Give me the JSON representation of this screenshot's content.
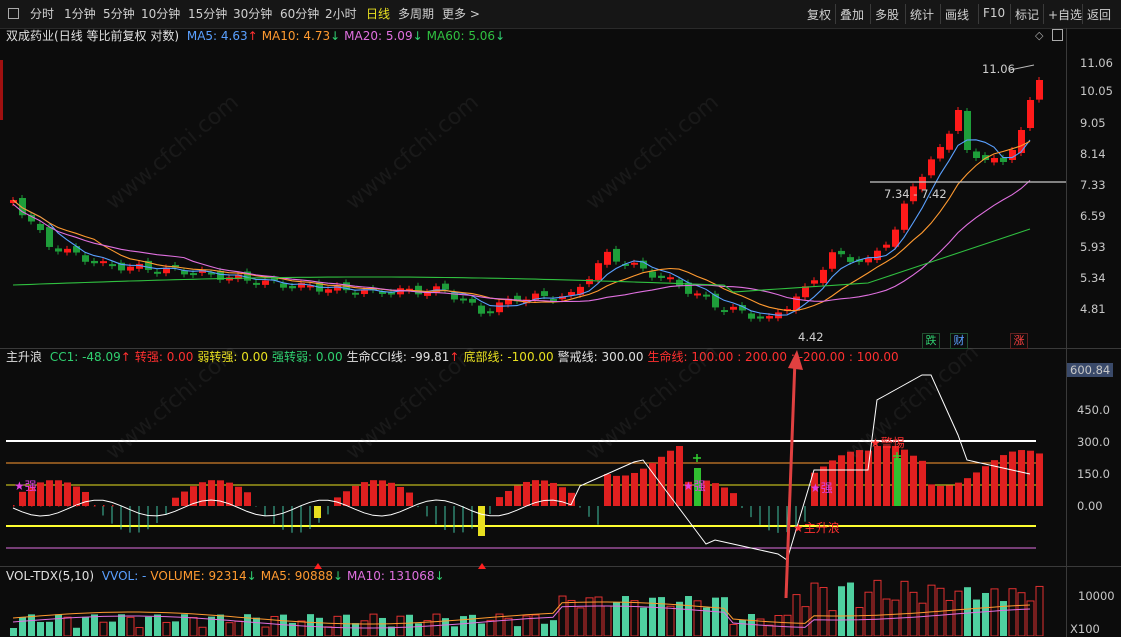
{
  "toolbar": {
    "left": [
      "分时",
      "1分钟",
      "5分钟",
      "10分钟",
      "15分钟",
      "30分钟",
      "60分钟",
      "2小时",
      "日线",
      "多周期",
      "更多 >"
    ],
    "active": "日线",
    "right": [
      "复权",
      "叠加",
      "多股",
      "统计",
      "画线",
      "F10",
      "标记",
      "+自选",
      "返回"
    ]
  },
  "main": {
    "title": "双成药业",
    "subtitle": "(日线 等比前复权 对数)",
    "ma": [
      {
        "label": "MA5: 4.63",
        "arrow": "↑",
        "color": "#5aa0ff",
        "arrow_color": "#ff3030"
      },
      {
        "label": "MA10: 4.73",
        "arrow": "↓",
        "color": "#ff9a30",
        "arrow_color": "#30d070"
      },
      {
        "label": "MA20: 5.09",
        "arrow": "↓",
        "color": "#e070e0",
        "arrow_color": "#30d070"
      },
      {
        "label": "MA60: 5.06",
        "arrow": "↓",
        "color": "#30c040",
        "arrow_color": "#30d070"
      }
    ],
    "price_axis": [
      "11.06",
      "10.05",
      "9.05",
      "8.14",
      "7.33",
      "6.59",
      "5.93",
      "5.34",
      "4.81"
    ],
    "annot_high": "11.06",
    "annot_low": "4.42",
    "annot_gap": "7.34 - 7.42",
    "badges": [
      {
        "t": "跌",
        "color": "#30d070"
      },
      {
        "t": "财",
        "color": "#5aa0ff"
      },
      {
        "t": "涨",
        "color": "#ff4040"
      }
    ]
  },
  "indicator": {
    "name": "主升浪",
    "items": [
      {
        "label": "CC1: -48.09",
        "arrow": "↑",
        "color": "#30d070",
        "arrow_color": "#ff3030"
      },
      {
        "label": "转强: 0.00",
        "color": "#ff3030"
      },
      {
        "label": "弱转强: 0.00",
        "color": "#e8e020"
      },
      {
        "label": "强转弱: 0.00",
        "color": "#30d070"
      },
      {
        "label": "生命CCI线: -99.81",
        "arrow": "↑",
        "color": "#e0e0e0",
        "arrow_color": "#ff3030"
      },
      {
        "label": "底部线: -100.00",
        "color": "#e8e020"
      },
      {
        "label": "警戒线: 300.00",
        "color": "#e0e0e0"
      },
      {
        "label": "生命线: 100.00 : 200.00 : -200.00 : 100.00",
        "color": "#ff3030"
      }
    ],
    "axis": [
      "600.84",
      "450.0",
      "300.0",
      "150.0",
      "0.00"
    ],
    "marks": [
      {
        "t": "★强",
        "color": "#e040e0"
      },
      {
        "t": "★强",
        "color": "#e040e0"
      },
      {
        "t": "★强",
        "color": "#e040e0"
      },
      {
        "t": "★警惕",
        "color": "#ff3030"
      },
      {
        "t": "★主升浪",
        "color": "#ff3030"
      }
    ]
  },
  "volume": {
    "name": "VOL-TDX(5,10)",
    "items": [
      {
        "label": "VVOL: -",
        "color": "#5aa0ff"
      },
      {
        "label": "VOLUME: 92314",
        "arrow": "↓",
        "color": "#ff9a30",
        "arrow_color": "#30d070"
      },
      {
        "label": "MA5: 90888",
        "arrow": "↓",
        "color": "#ff9a30",
        "arrow_color": "#30d070"
      },
      {
        "label": "MA10: 131068",
        "arrow": "↓",
        "color": "#e070e0",
        "arrow_color": "#30d070"
      }
    ],
    "axis": [
      "10000",
      "X100"
    ]
  },
  "watermark": "www.cfchi.com"
}
